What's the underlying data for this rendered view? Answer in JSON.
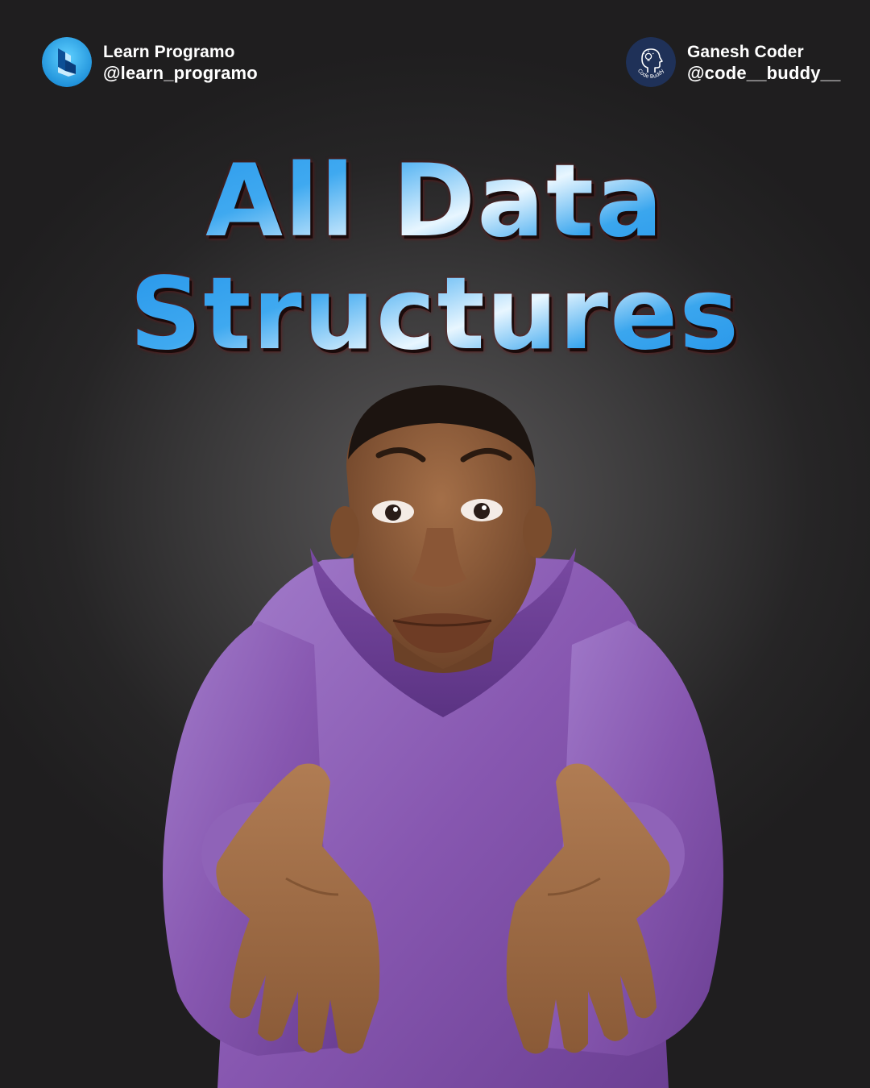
{
  "header": {
    "left": {
      "name": "Learn Programo",
      "handle": "@learn_programo",
      "icon": "learn-programo-logo-icon"
    },
    "right": {
      "name": "Ganesh Coder",
      "handle": "@code__buddy__",
      "icon": "code-buddy-logo-icon",
      "logo_text": "Code Buddy"
    }
  },
  "headline": {
    "line1": "All Data",
    "line2": "Structures"
  },
  "illustration": {
    "icon": "shrugging-person-illustration"
  },
  "colors": {
    "background": "#3b3a3b",
    "headline_blue": "#1c8ee8",
    "hoodie_purple": "#8a5bb0"
  }
}
